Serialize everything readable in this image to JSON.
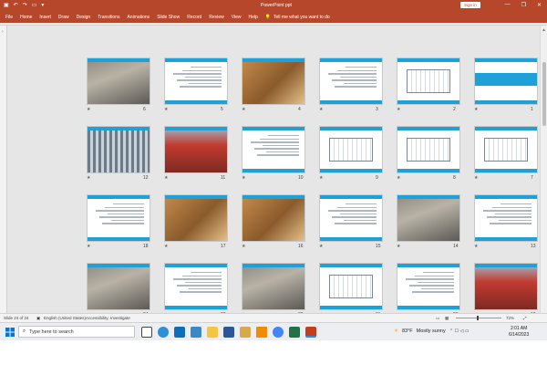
{
  "titlebar": {
    "title": "PowerPoint",
    "doc_name": "ppt",
    "sign_in": "Sign in",
    "minimize": "—",
    "restore": "❐",
    "close": "✕"
  },
  "ribbon_tabs": [
    "File",
    "Home",
    "Insert",
    "Draw",
    "Design",
    "Transitions",
    "Animations",
    "Slide Show",
    "Record",
    "Review",
    "View",
    "Help"
  ],
  "tell_me": "Tell me what you want to do",
  "slides": [
    {
      "n": "6"
    },
    {
      "n": "5"
    },
    {
      "n": "4"
    },
    {
      "n": "3"
    },
    {
      "n": "2"
    },
    {
      "n": "1"
    },
    {
      "n": "12"
    },
    {
      "n": "11"
    },
    {
      "n": "10"
    },
    {
      "n": "9"
    },
    {
      "n": "8"
    },
    {
      "n": "7"
    },
    {
      "n": "18"
    },
    {
      "n": "17"
    },
    {
      "n": "16"
    },
    {
      "n": "15"
    },
    {
      "n": "14"
    },
    {
      "n": "13"
    },
    {
      "n": "24"
    },
    {
      "n": "23"
    },
    {
      "n": "22"
    },
    {
      "n": "21"
    },
    {
      "n": "20"
    },
    {
      "n": "19"
    }
  ],
  "status": {
    "slide_pos": "Slide 24 of 24",
    "language": "English (United States)",
    "accessibility": "Accessibility: Investigate",
    "zoom": "72%"
  },
  "taskbar": {
    "search_placeholder": "Type here to search",
    "weather_temp": "83°F",
    "weather_text": "Mostly sunny",
    "time": "2:01 AM",
    "date": "6/14/2023"
  },
  "colors": {
    "accent": "#b7472a",
    "slide_blue": "#1ea0d8"
  }
}
